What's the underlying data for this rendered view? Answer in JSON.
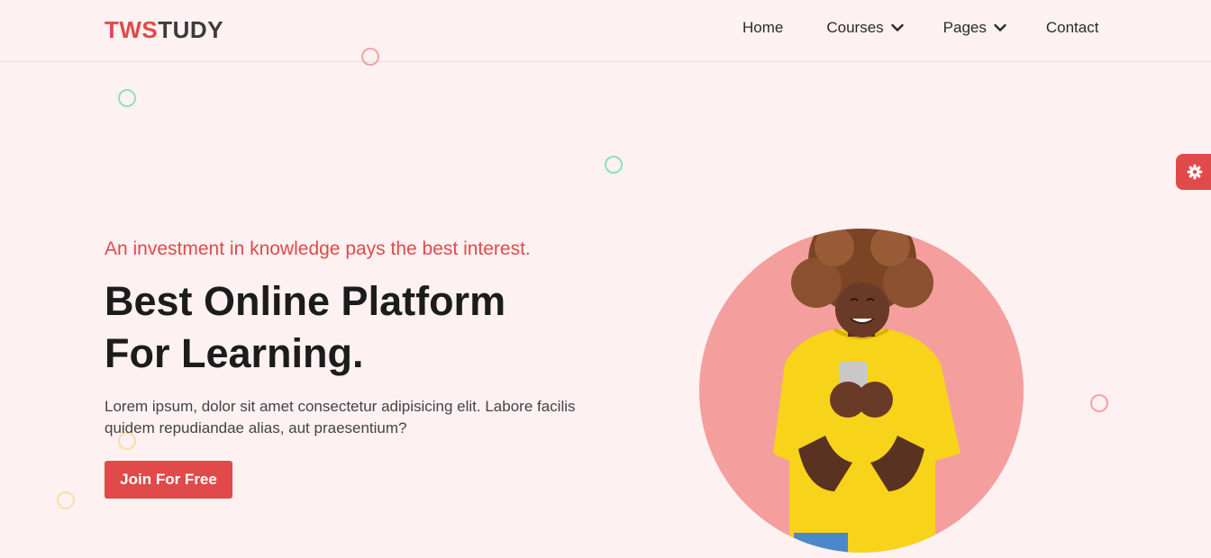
{
  "brand": {
    "part1": "TWS",
    "part2": "TUDY"
  },
  "nav": {
    "home": "Home",
    "courses": "Courses",
    "pages": "Pages",
    "contact": "Contact"
  },
  "hero": {
    "tagline": "An investment in knowledge pays the best interest.",
    "headline_line1": "Best Online Platform",
    "headline_line2": "For Learning.",
    "description": "Lorem ipsum, dolor sit amet consectetur adipisicing elit. Labore facilis quidem repudiandae alias, aut praesentium?",
    "cta_label": "Join For Free",
    "image_icon": "student-with-phone-illustration"
  },
  "settings_icon": "gear-icon",
  "colors": {
    "accent": "#e04a4a",
    "background": "#fdf1f1",
    "hero_circle": "#f49e9e",
    "deco_green": "#8ee0c1",
    "deco_pink": "#f2a3a3",
    "deco_yellow": "#f8e0a6"
  }
}
